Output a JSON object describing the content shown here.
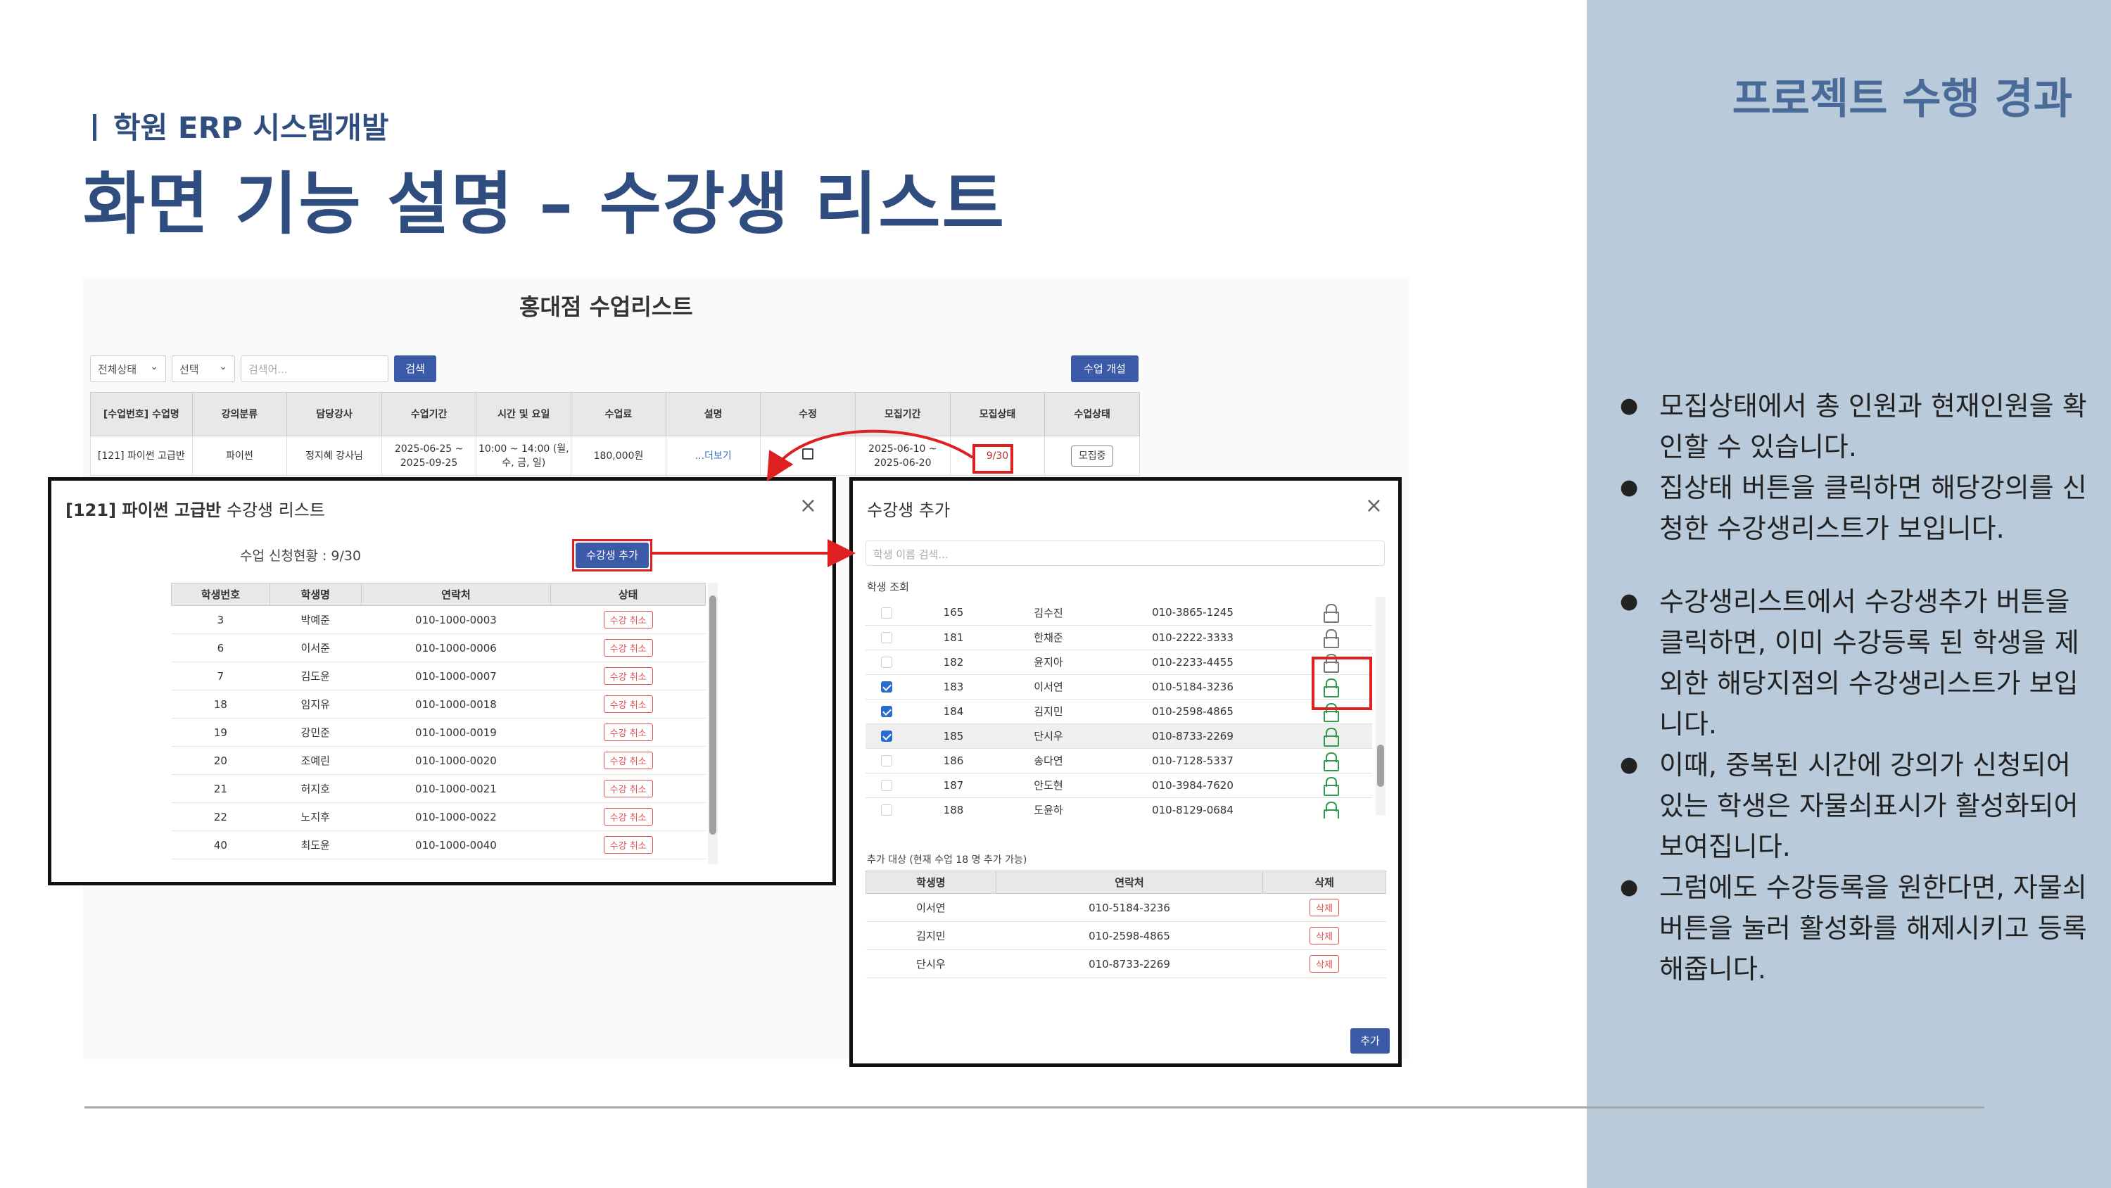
{
  "header": {
    "subtitle": "학원 ERP 시스템개발",
    "title": "화면 기능 설명 – 수강생 리스트",
    "section": "프로젝트 수행 경과"
  },
  "bullets": [
    "모집상태에서 총 인원과 현재인원을 확인할 수 있습니다.",
    "집상태 버튼을 클릭하면 해당강의를 신청한 수강생리스트가 보입니다.",
    "수강생리스트에서 수강생추가 버튼을 클릭하면, 이미 수강등록 된 학생을 제외한 해당지점의 수강생리스트가 보입니다.",
    "이때, 중복된 시간에 강의가 신청되어있는 학생은 자물쇠표시가 활성화되어 보여집니다.",
    "그럼에도 수강등록을 원한다면, 자물쇠버튼을 눌러 활성화를 해제시키고 등록해줍니다."
  ],
  "class_list": {
    "title": "홍대점 수업리스트",
    "filter_status": "전체상태",
    "filter_select": "선택",
    "search_placeholder": "검색어...",
    "search_button": "검색",
    "open_button": "수업 개설",
    "headers": [
      "[수업번호] 수업명",
      "강의분류",
      "담당강사",
      "수업기간",
      "시간 및 요일",
      "수업료",
      "설명",
      "수정",
      "모집기간",
      "모집상태",
      "수업상태"
    ],
    "row": {
      "name": "[121] 파이썬 고급반",
      "category": "파이썬",
      "teacher": "정지혜 강사님",
      "period": "2025-06-25 ~ 2025-09-25",
      "time": "10:00 ~ 14:00 (월, 수, 금, 일)",
      "fee": "180,000원",
      "desc": "...더보기",
      "recruit_period": "2025-06-10 ~ 2025-06-20",
      "recruit_status": "9/30",
      "class_status": "모집중"
    }
  },
  "student_modal": {
    "title_bold": "[121] 파이썬 고급반",
    "title_rest": "수강생 리스트",
    "status_text": "수업 신청현황 : 9/30",
    "add_button": "수강생 추가",
    "headers": [
      "학생번호",
      "학생명",
      "연락처",
      "상태"
    ],
    "cancel_label": "수강 취소",
    "rows": [
      {
        "id": "3",
        "name": "박예준",
        "phone": "010-1000-0003"
      },
      {
        "id": "6",
        "name": "이서준",
        "phone": "010-1000-0006"
      },
      {
        "id": "7",
        "name": "김도윤",
        "phone": "010-1000-0007"
      },
      {
        "id": "18",
        "name": "임지유",
        "phone": "010-1000-0018"
      },
      {
        "id": "19",
        "name": "강민준",
        "phone": "010-1000-0019"
      },
      {
        "id": "20",
        "name": "조예린",
        "phone": "010-1000-0020"
      },
      {
        "id": "21",
        "name": "허지호",
        "phone": "010-1000-0021"
      },
      {
        "id": "22",
        "name": "노지후",
        "phone": "010-1000-0022"
      },
      {
        "id": "40",
        "name": "최도윤",
        "phone": "010-1000-0040"
      }
    ]
  },
  "add_modal": {
    "title": "수강생 추가",
    "search_placeholder": "학생 이름 검색...",
    "lookup_label": "학생 조회",
    "rows": [
      {
        "id": "165",
        "name": "김수진",
        "phone": "010-3865-1245",
        "checked": false,
        "lock": "gray"
      },
      {
        "id": "181",
        "name": "한채준",
        "phone": "010-2222-3333",
        "checked": false,
        "lock": "gray"
      },
      {
        "id": "182",
        "name": "윤지아",
        "phone": "010-2233-4455",
        "checked": false,
        "lock": "gray"
      },
      {
        "id": "183",
        "name": "이서연",
        "phone": "010-5184-3236",
        "checked": true,
        "lock": "green"
      },
      {
        "id": "184",
        "name": "김지민",
        "phone": "010-2598-4865",
        "checked": true,
        "lock": "green"
      },
      {
        "id": "185",
        "name": "단시우",
        "phone": "010-8733-2269",
        "checked": true,
        "lock": "green"
      },
      {
        "id": "186",
        "name": "송다연",
        "phone": "010-7128-5337",
        "checked": false,
        "lock": "green"
      },
      {
        "id": "187",
        "name": "안도현",
        "phone": "010-3984-7620",
        "checked": false,
        "lock": "green"
      },
      {
        "id": "188",
        "name": "도윤하",
        "phone": "010-8129-0684",
        "checked": false,
        "lock": "green"
      }
    ],
    "target_label": "추가 대상 (현재 수업 18 명 추가 가능)",
    "target_headers": [
      "학생명",
      "연락처",
      "삭제"
    ],
    "delete_label": "삭제",
    "targets": [
      {
        "name": "이서연",
        "phone": "010-5184-3236"
      },
      {
        "name": "김지민",
        "phone": "010-2598-4865"
      },
      {
        "name": "단시우",
        "phone": "010-8733-2269"
      }
    ],
    "submit_button": "추가"
  },
  "colors": {
    "accent": "#2f4d7e",
    "panel": "#b9cadb",
    "highlight": "#e02020",
    "lock_active": "#2f9a4e"
  }
}
